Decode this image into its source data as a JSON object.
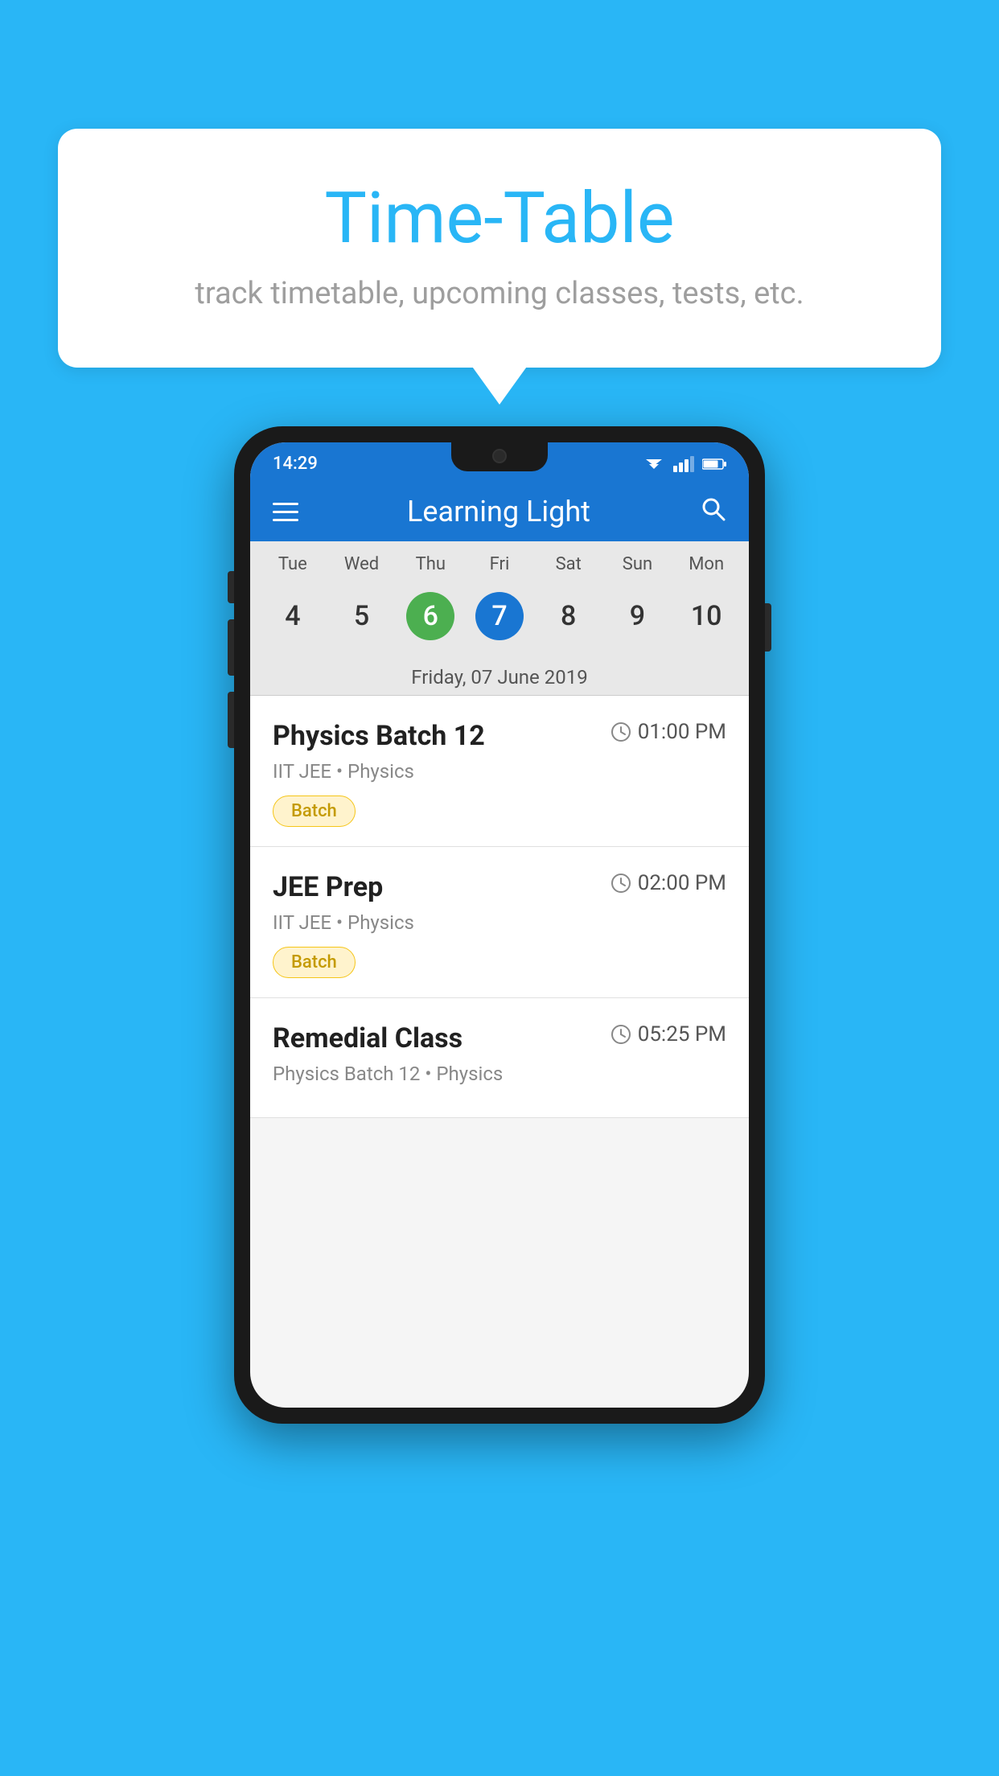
{
  "background_color": "#29b6f6",
  "speech_bubble": {
    "title": "Time-Table",
    "subtitle": "track timetable, upcoming classes, tests, etc."
  },
  "phone": {
    "status_bar": {
      "time": "14:29"
    },
    "app_bar": {
      "title": "Learning Light"
    },
    "calendar": {
      "day_headers": [
        "Tue",
        "Wed",
        "Thu",
        "Fri",
        "Sat",
        "Sun",
        "Mon"
      ],
      "day_numbers": [
        {
          "num": "4",
          "state": "normal"
        },
        {
          "num": "5",
          "state": "normal"
        },
        {
          "num": "6",
          "state": "today"
        },
        {
          "num": "7",
          "state": "selected"
        },
        {
          "num": "8",
          "state": "normal"
        },
        {
          "num": "9",
          "state": "normal"
        },
        {
          "num": "10",
          "state": "normal"
        }
      ],
      "selected_date_label": "Friday, 07 June 2019"
    },
    "schedule": [
      {
        "title": "Physics Batch 12",
        "time": "01:00 PM",
        "meta": "IIT JEE • Physics",
        "tag": "Batch"
      },
      {
        "title": "JEE Prep",
        "time": "02:00 PM",
        "meta": "IIT JEE • Physics",
        "tag": "Batch"
      },
      {
        "title": "Remedial Class",
        "time": "05:25 PM",
        "meta": "Physics Batch 12 • Physics",
        "tag": ""
      }
    ]
  },
  "icons": {
    "hamburger": "☰",
    "search": "🔍",
    "clock": "⏰"
  }
}
